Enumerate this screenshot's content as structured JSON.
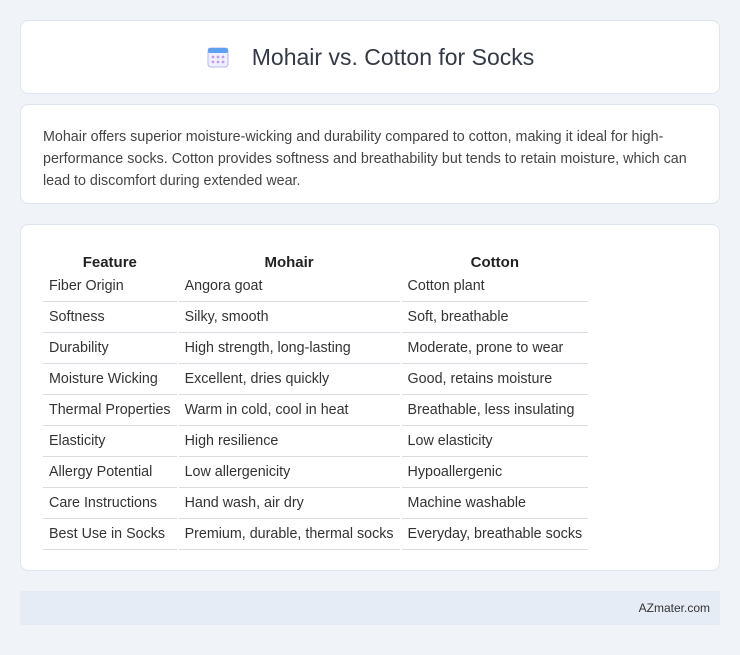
{
  "header": {
    "icon": "calendar-icon",
    "title": "Mohair vs. Cotton for Socks"
  },
  "summary": {
    "text": "Mohair offers superior moisture-wicking and durability compared to cotton, making it ideal for high-performance socks. Cotton provides softness and breathability but tends to retain moisture, which can lead to discomfort during extended wear."
  },
  "table": {
    "headers": [
      "Feature",
      "Mohair",
      "Cotton"
    ],
    "rows": [
      [
        "Fiber Origin",
        "Angora goat",
        "Cotton plant"
      ],
      [
        "Softness",
        "Silky, smooth",
        "Soft, breathable"
      ],
      [
        "Durability",
        "High strength, long-lasting",
        "Moderate, prone to wear"
      ],
      [
        "Moisture Wicking",
        "Excellent, dries quickly",
        "Good, retains moisture"
      ],
      [
        "Thermal Properties",
        "Warm in cold, cool in heat",
        "Breathable, less insulating"
      ],
      [
        "Elasticity",
        "High resilience",
        "Low elasticity"
      ],
      [
        "Allergy Potential",
        "Low allergenicity",
        "Hypoallergenic"
      ],
      [
        "Care Instructions",
        "Hand wash, air dry",
        "Machine washable"
      ],
      [
        "Best Use in Socks",
        "Premium, durable, thermal socks",
        "Everyday, breathable socks"
      ]
    ]
  },
  "footer": {
    "brand": "AZmater.com"
  },
  "colors": {
    "background": "#f0f3f8",
    "card": "#ffffff",
    "footer": "#e6ecf6",
    "icon_accent": "#8a7fe0"
  }
}
